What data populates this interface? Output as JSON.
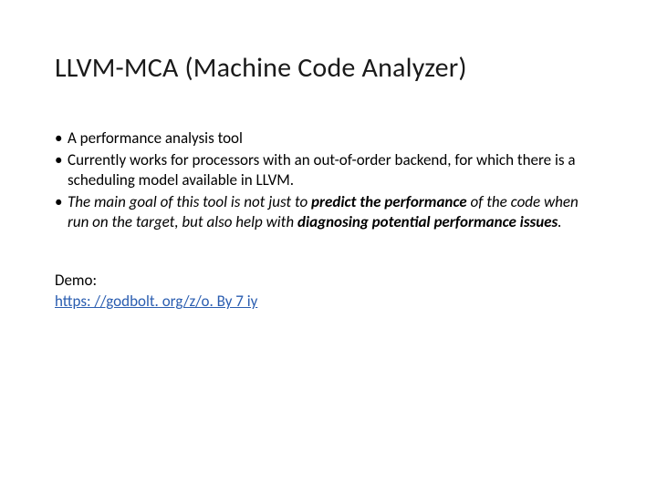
{
  "title": "LLVM-MCA (Machine Code Analyzer)",
  "bullets": {
    "b0": "A performance analysis tool",
    "b1": "Currently works for processors with an out-of-order backend, for which there is a scheduling model available in LLVM.",
    "b2_pre": "The main goal of this tool is not just to ",
    "b2_bold1": "predict the performance",
    "b2_mid": " of the code when run on the target, but also help with ",
    "b2_bold2": "diagnosing potential performance issues",
    "b2_post": "."
  },
  "demo": {
    "label": "Demo:",
    "link_text": "https: //godbolt. org/z/o. By 7 iy"
  }
}
